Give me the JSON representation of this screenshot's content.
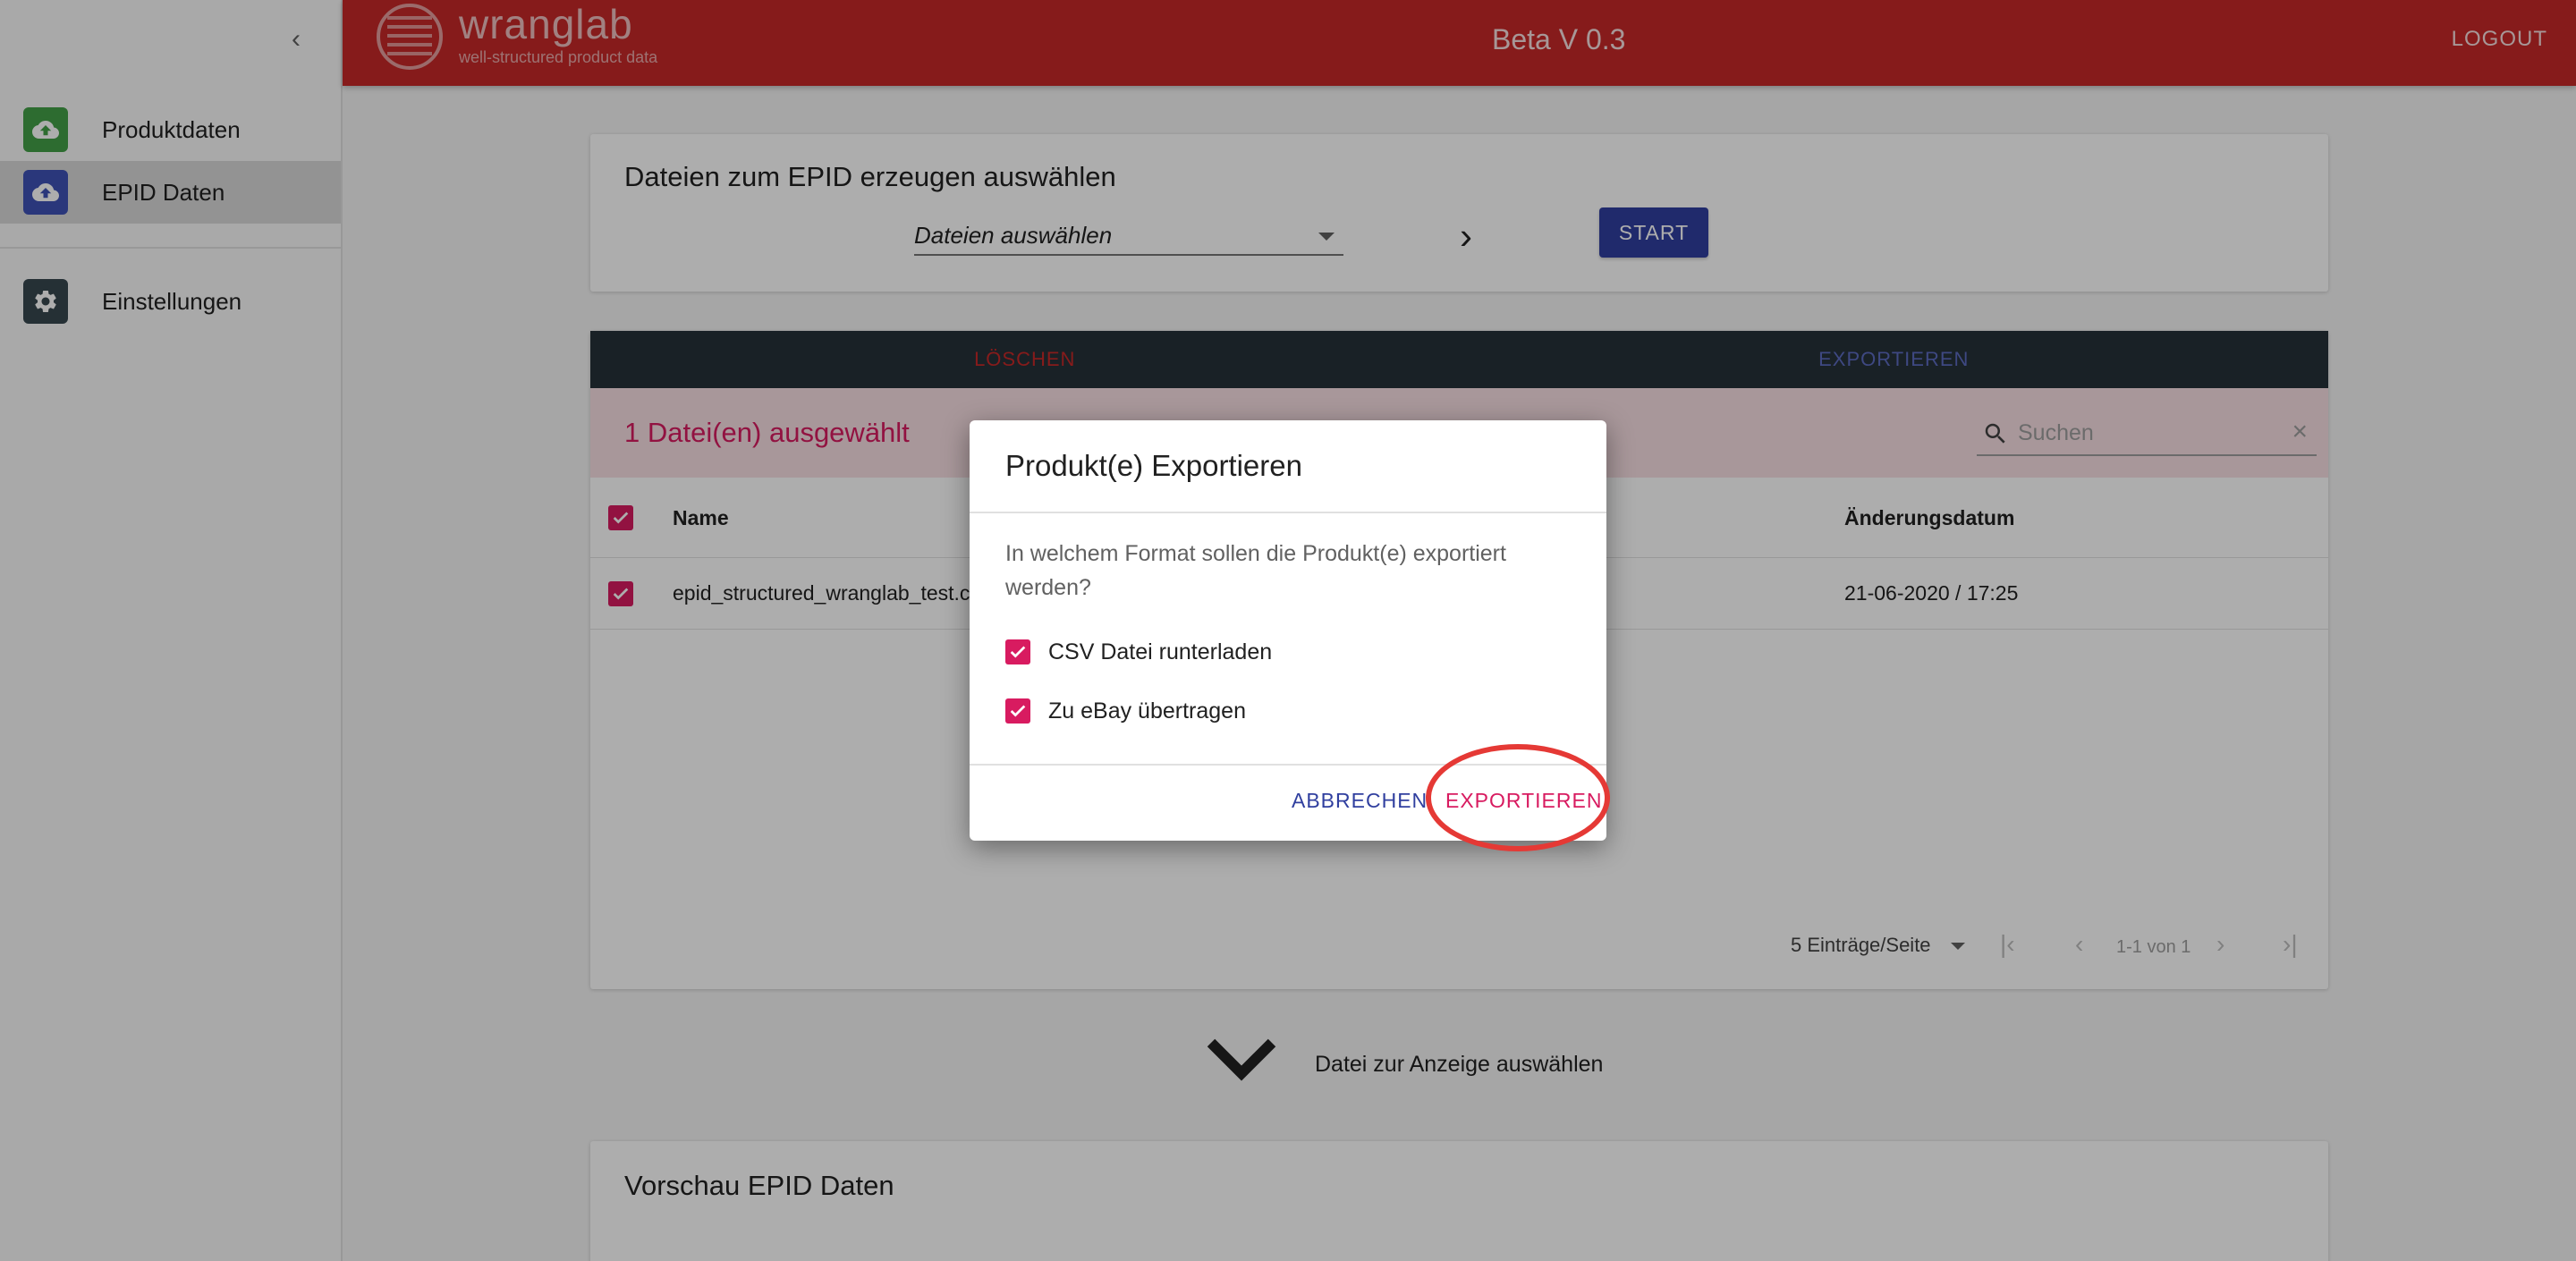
{
  "sidebar": {
    "items": [
      {
        "label": "Produktdaten",
        "icon": "cloud-upload-icon",
        "color": "#43a047"
      },
      {
        "label": "EPID Daten",
        "icon": "cloud-upload-icon",
        "color": "#3f51b5"
      },
      {
        "label": "Einstellungen",
        "icon": "gear-icon",
        "color": "#37474f"
      }
    ]
  },
  "topbar": {
    "logo_text": "wranglab",
    "logo_sub": "well-structured product data",
    "version": "Beta V 0.3",
    "logout": "LOGOUT"
  },
  "generate": {
    "title": "Dateien zum EPID erzeugen auswählen",
    "select_value": "Dateien auswählen",
    "start": "START"
  },
  "files": {
    "tabs": [
      "LÖSCHEN",
      "EXPORTIEREN"
    ],
    "selected_text": "1 Datei(en) ausgewählt",
    "search_placeholder": "Suchen",
    "columns": [
      "Name",
      "Änderungsdatum"
    ],
    "rows": [
      {
        "name": "epid_structured_wranglab_test.c",
        "date": "21-06-2020 / 17:25",
        "checked": true
      }
    ],
    "pager": {
      "per_page": "5 Einträge/Seite",
      "range": "1-1 von 1"
    }
  },
  "hint": "Datei zur Anzeige auswählen",
  "preview": {
    "title": "Vorschau EPID Daten"
  },
  "dialog": {
    "title": "Produkt(e) Exportieren",
    "question": "In welchem Format sollen die Produkt(e) exportiert werden?",
    "options": [
      {
        "label": "CSV Datei runterladen",
        "checked": true
      },
      {
        "label": "Zu eBay übertragen",
        "checked": true
      }
    ],
    "cancel": "ABBRECHEN",
    "confirm": "EXPORTIEREN"
  },
  "colors": {
    "brand": "#c62828",
    "accent": "#d81b60",
    "primary": "#303f9f"
  }
}
